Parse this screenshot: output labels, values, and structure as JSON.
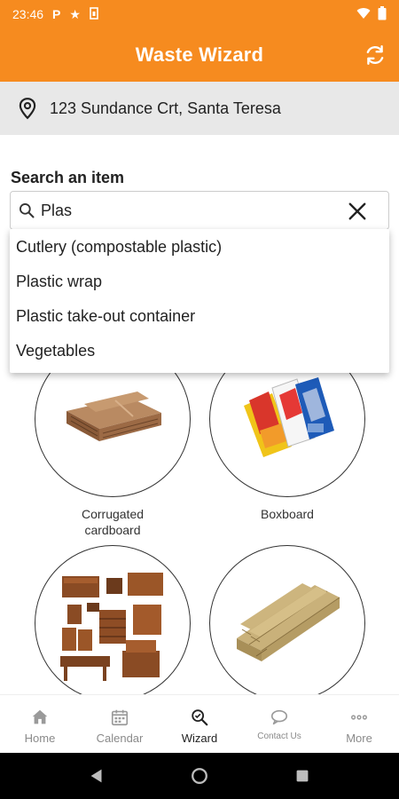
{
  "status": {
    "time": "23:46",
    "icons": [
      "parking-icon",
      "star-icon",
      "sim-icon",
      "wifi-icon",
      "battery-icon"
    ]
  },
  "app": {
    "title": "Waste Wizard"
  },
  "address": {
    "text": "123 Sundance Crt, Santa Teresa"
  },
  "search": {
    "label": "Search an item",
    "query": "Plas",
    "suggestions": [
      "Cutlery (compostable plastic)",
      "Plastic wrap",
      "Plastic take-out container",
      "Vegetables"
    ]
  },
  "categories": [
    {
      "label": "Corrugated cardboard",
      "image": "cardboard"
    },
    {
      "label": "Boxboard",
      "image": "boxboard"
    },
    {
      "label": "",
      "image": "furniture"
    },
    {
      "label": "",
      "image": "lumber"
    }
  ],
  "nav": {
    "items": [
      {
        "label": "Home",
        "icon": "home-icon",
        "active": false
      },
      {
        "label": "Calendar",
        "icon": "calendar-icon",
        "active": false
      },
      {
        "label": "Wizard",
        "icon": "wizard-icon",
        "active": true
      },
      {
        "label": "Contact Us",
        "icon": "chat-icon",
        "active": false
      },
      {
        "label": "More",
        "icon": "more-icon",
        "active": false
      }
    ]
  },
  "colors": {
    "brand": "#f68b1f",
    "address_bg": "#e8e8e8"
  }
}
